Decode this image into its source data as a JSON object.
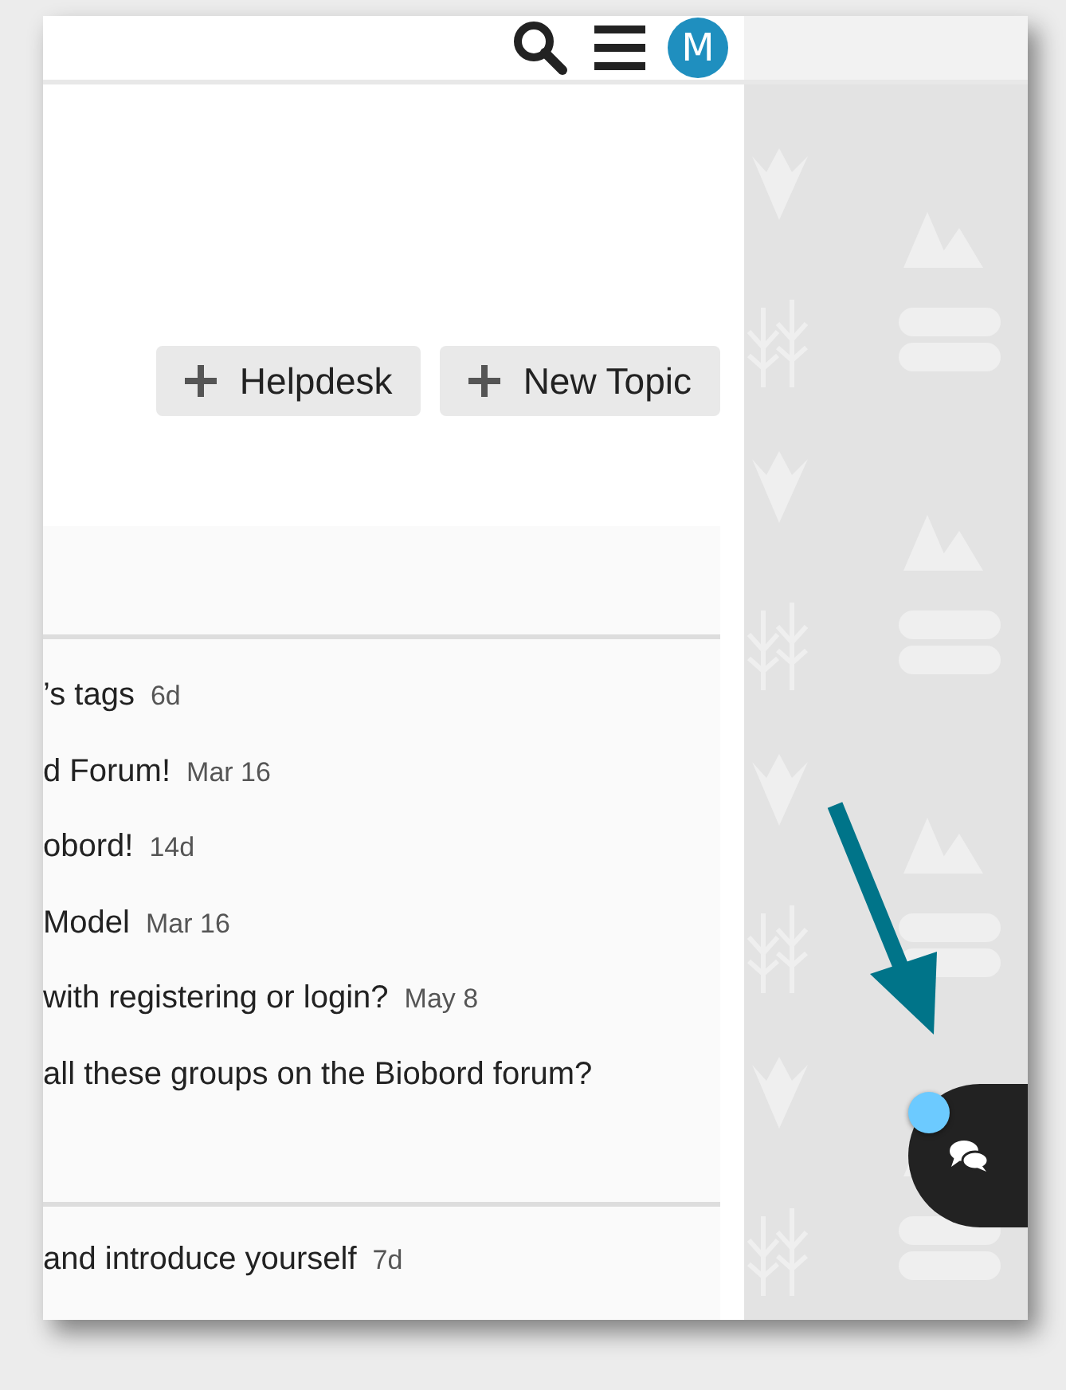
{
  "header": {
    "avatar_letter": "M"
  },
  "actions": [
    {
      "label": "Helpdesk"
    },
    {
      "label": "New Topic"
    }
  ],
  "topic_groups": [
    {
      "topics": [
        {
          "title": "’s tags",
          "age": "6d"
        },
        {
          "title": "d Forum!",
          "age": "Mar 16"
        },
        {
          "title": "obord!",
          "age": "14d"
        },
        {
          "title": "Model",
          "age": "Mar 16"
        },
        {
          "title": "with registering or login?",
          "age": "May 8"
        },
        {
          "title": "all these groups on the Biobord forum?"
        }
      ]
    },
    {
      "topics": [
        {
          "title": "and introduce yourself",
          "age": "7d"
        }
      ]
    }
  ],
  "chat": {
    "unread": true
  }
}
